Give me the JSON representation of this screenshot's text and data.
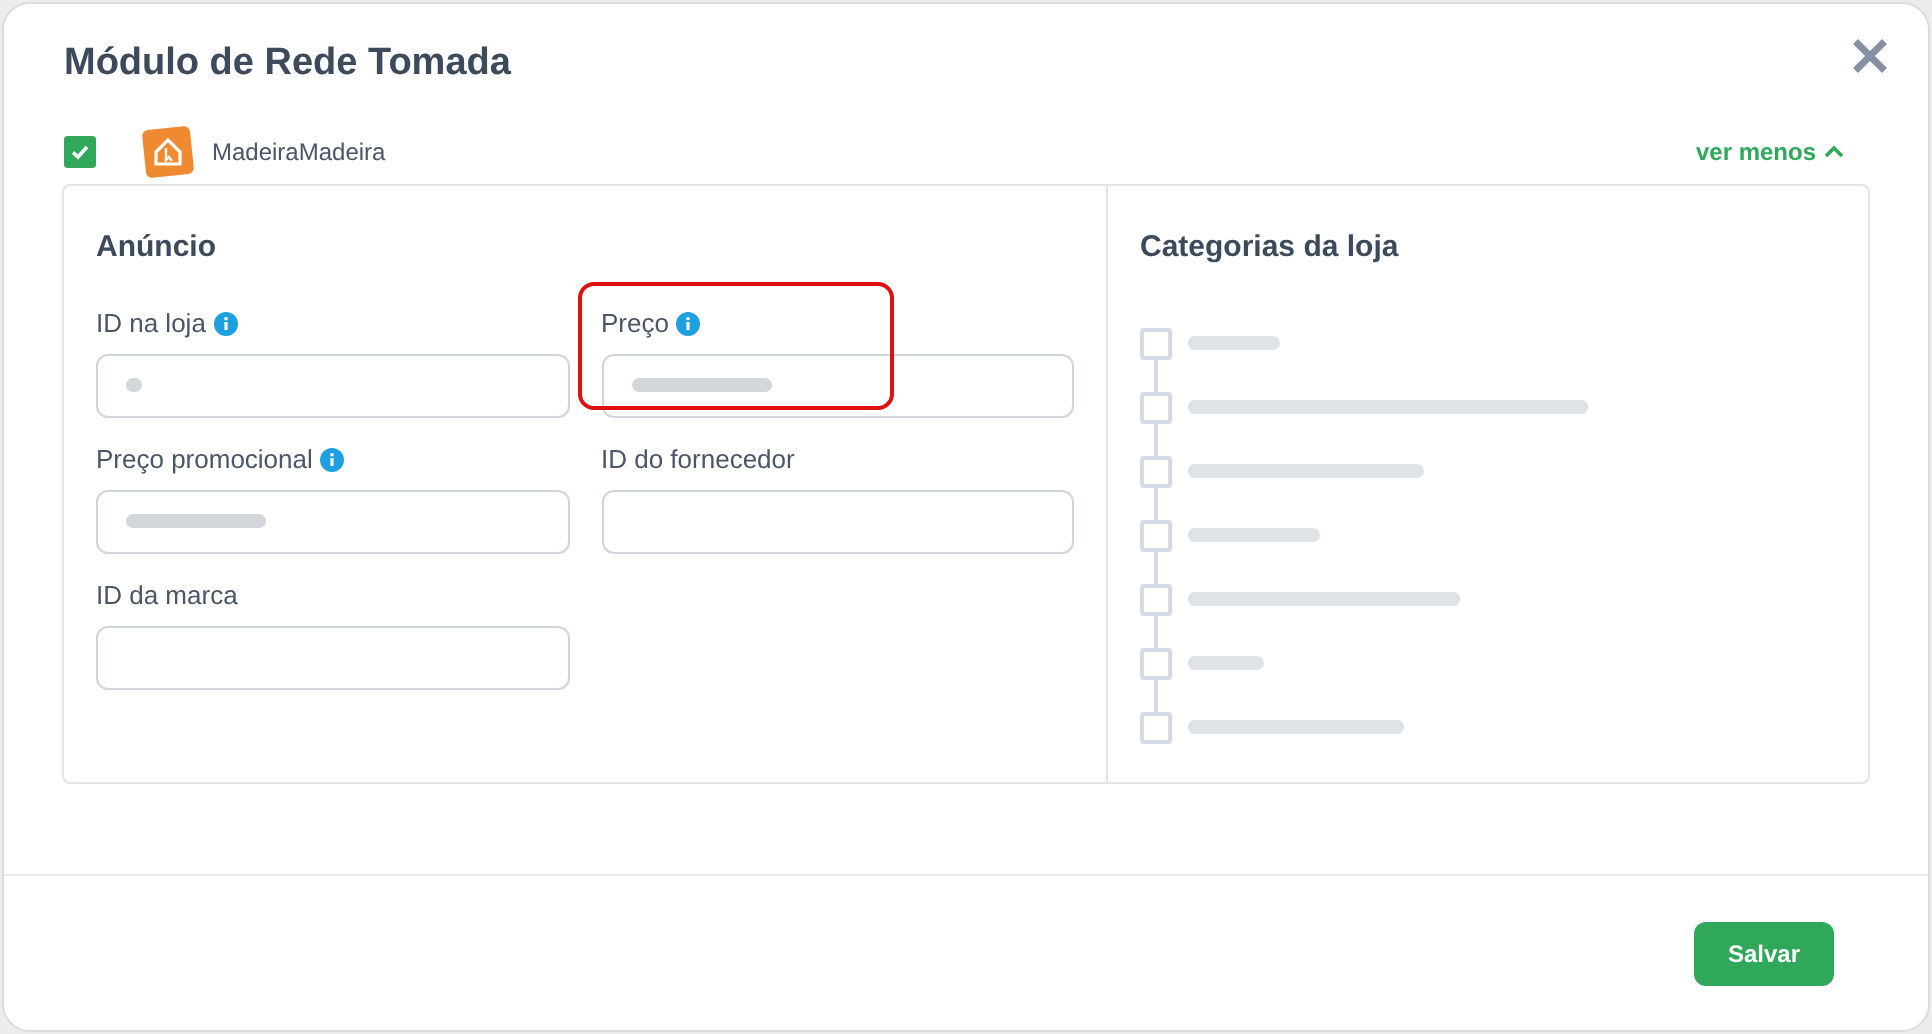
{
  "modal": {
    "title": "Módulo de Rede Tomada"
  },
  "store": {
    "name": "MadeiraMadeira",
    "checked": true,
    "toggle": "ver menos"
  },
  "ad_section": {
    "title": "Anúncio",
    "fields": [
      {
        "label": "ID na loja",
        "info": true,
        "redacted": true,
        "highlighted": false
      },
      {
        "label": "Preço",
        "info": true,
        "redacted": true,
        "highlighted": true
      },
      {
        "label": "Preço promocional",
        "info": true,
        "redacted": true,
        "highlighted": false
      },
      {
        "label": "ID do fornecedor",
        "info": false,
        "redacted": false,
        "highlighted": false
      },
      {
        "label": "ID da marca",
        "info": false,
        "redacted": false,
        "highlighted": false
      }
    ]
  },
  "categories": {
    "title": "Categorias da loja",
    "items": [
      {
        "checked": false
      },
      {
        "checked": false
      },
      {
        "checked": false
      },
      {
        "checked": false
      },
      {
        "checked": false
      },
      {
        "checked": false
      },
      {
        "checked": false
      }
    ]
  },
  "footer": {
    "save": "Salvar"
  }
}
